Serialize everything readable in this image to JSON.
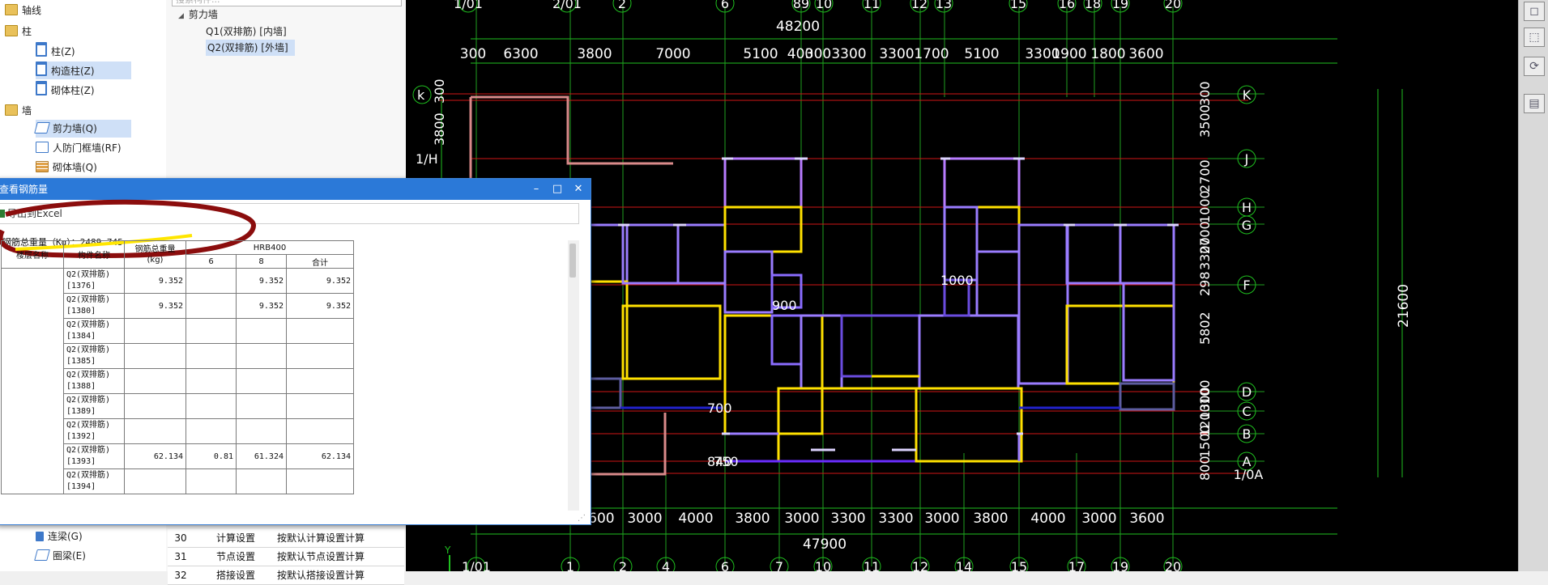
{
  "tree": {
    "items": [
      {
        "label": "轴线",
        "icon": "axis-folder-icon",
        "level": 0
      },
      {
        "label": "柱",
        "icon": "column-folder-icon",
        "level": 0
      },
      {
        "label": "柱(Z)",
        "icon": "column-icon",
        "level": 1
      },
      {
        "label": "构造柱(Z)",
        "icon": "constructional-column-icon",
        "level": 1
      },
      {
        "label": "砌体柱(Z)",
        "icon": "masonry-column-icon",
        "level": 1
      },
      {
        "label": "墙",
        "icon": "wall-folder-icon",
        "level": 0
      },
      {
        "label": "剪力墙(Q)",
        "icon": "shear-wall-icon",
        "level": 1
      },
      {
        "label": "人防门框墙(RF)",
        "icon": "civil-defense-door-wall-icon",
        "level": 1
      },
      {
        "label": "砌体墙(Q)",
        "icon": "masonry-wall-icon",
        "level": 1
      }
    ],
    "bottom_items": [
      {
        "label": "连梁(G)",
        "icon": "coupling-beam-icon"
      },
      {
        "label": "圈梁(E)",
        "icon": "ring-beam-icon"
      }
    ]
  },
  "mid": {
    "search_placeholder": "搜索构件...",
    "group": "剪力墙",
    "items": [
      "Q1(双排筋) [内墙]",
      "Q2(双排筋) [外墙]"
    ],
    "props": [
      {
        "no": "30",
        "name": "计算设置",
        "value": "按默认计算设置计算"
      },
      {
        "no": "31",
        "name": "节点设置",
        "value": "按默认节点设置计算"
      },
      {
        "no": "32",
        "name": "搭接设置",
        "value": "按默认搭接设置计算"
      }
    ]
  },
  "dialog": {
    "title": "查看钢筋量",
    "toolbar_export": "导出到Excel",
    "total_label": "钢筋总重量（Kg）：2489.745",
    "headers": {
      "floor": "楼层名称",
      "component": "构件名称",
      "weight": "钢筋总重量\n(kg)",
      "grade": "HRB400",
      "d6": "6",
      "d8": "8",
      "sum": "合计"
    },
    "rows": [
      {
        "comp": "Q2(双排筋)[1376]",
        "weight": "9.352",
        "d6": "",
        "d8": "9.352",
        "sum": "9.352"
      },
      {
        "comp": "Q2(双排筋)[1380]",
        "weight": "9.352",
        "d6": "",
        "d8": "9.352",
        "sum": "9.352"
      },
      {
        "comp": "Q2(双排筋)[1384]",
        "weight": "",
        "d6": "",
        "d8": "",
        "sum": ""
      },
      {
        "comp": "Q2(双排筋)[1385]",
        "weight": "",
        "d6": "",
        "d8": "",
        "sum": ""
      },
      {
        "comp": "Q2(双排筋)[1388]",
        "weight": "",
        "d6": "",
        "d8": "",
        "sum": ""
      },
      {
        "comp": "Q2(双排筋)[1389]",
        "weight": "",
        "d6": "",
        "d8": "",
        "sum": ""
      },
      {
        "comp": "Q2(双排筋)[1392]",
        "weight": "",
        "d6": "",
        "d8": "",
        "sum": ""
      },
      {
        "comp": "Q2(双排筋)[1393]",
        "weight": "62.134",
        "d6": "0.81",
        "d8": "61.324",
        "sum": "62.134"
      },
      {
        "comp": "Q2(双排筋)[1394]",
        "weight": "",
        "d6": "",
        "d8": "",
        "sum": ""
      }
    ]
  },
  "cad": {
    "top_total": "48200",
    "bottom_total": "47900",
    "right_total": "21600",
    "top_axes": [
      "1/01",
      "2/01",
      "2",
      "6",
      "89",
      "10",
      "11",
      "12",
      "13",
      "15",
      "16",
      "18",
      "19",
      "20"
    ],
    "top_dims": [
      "300",
      "6300",
      "3800",
      "7000",
      "5100",
      "400",
      "300",
      "3300",
      "3300",
      "1700",
      "5100",
      "3300",
      "1900",
      "1800",
      "3600"
    ],
    "bottom_dims": [
      "3600",
      "3000",
      "4000",
      "3800",
      "3000",
      "3300",
      "3300",
      "3000",
      "3800",
      "4000",
      "3000",
      "3600"
    ],
    "bottom_axes": [
      "1/01",
      "1",
      "2",
      "4",
      "6",
      "7",
      "10",
      "11",
      "12",
      "14",
      "15",
      "17",
      "19",
      "20"
    ],
    "right_axes": [
      "K",
      "J",
      "H",
      "G",
      "F",
      "D",
      "C",
      "B",
      "A",
      "1/0A"
    ],
    "right_dims": [
      "300",
      "3500",
      "2700",
      "1000",
      "2700",
      "3300",
      "298",
      "5802",
      "100",
      "1300",
      "1200",
      "1500",
      "800"
    ],
    "left_axes": [
      "k",
      "1/H"
    ],
    "left_dims": [
      "300",
      "3800"
    ],
    "labels": [
      "1000",
      "900",
      "700",
      "840",
      "750"
    ]
  }
}
